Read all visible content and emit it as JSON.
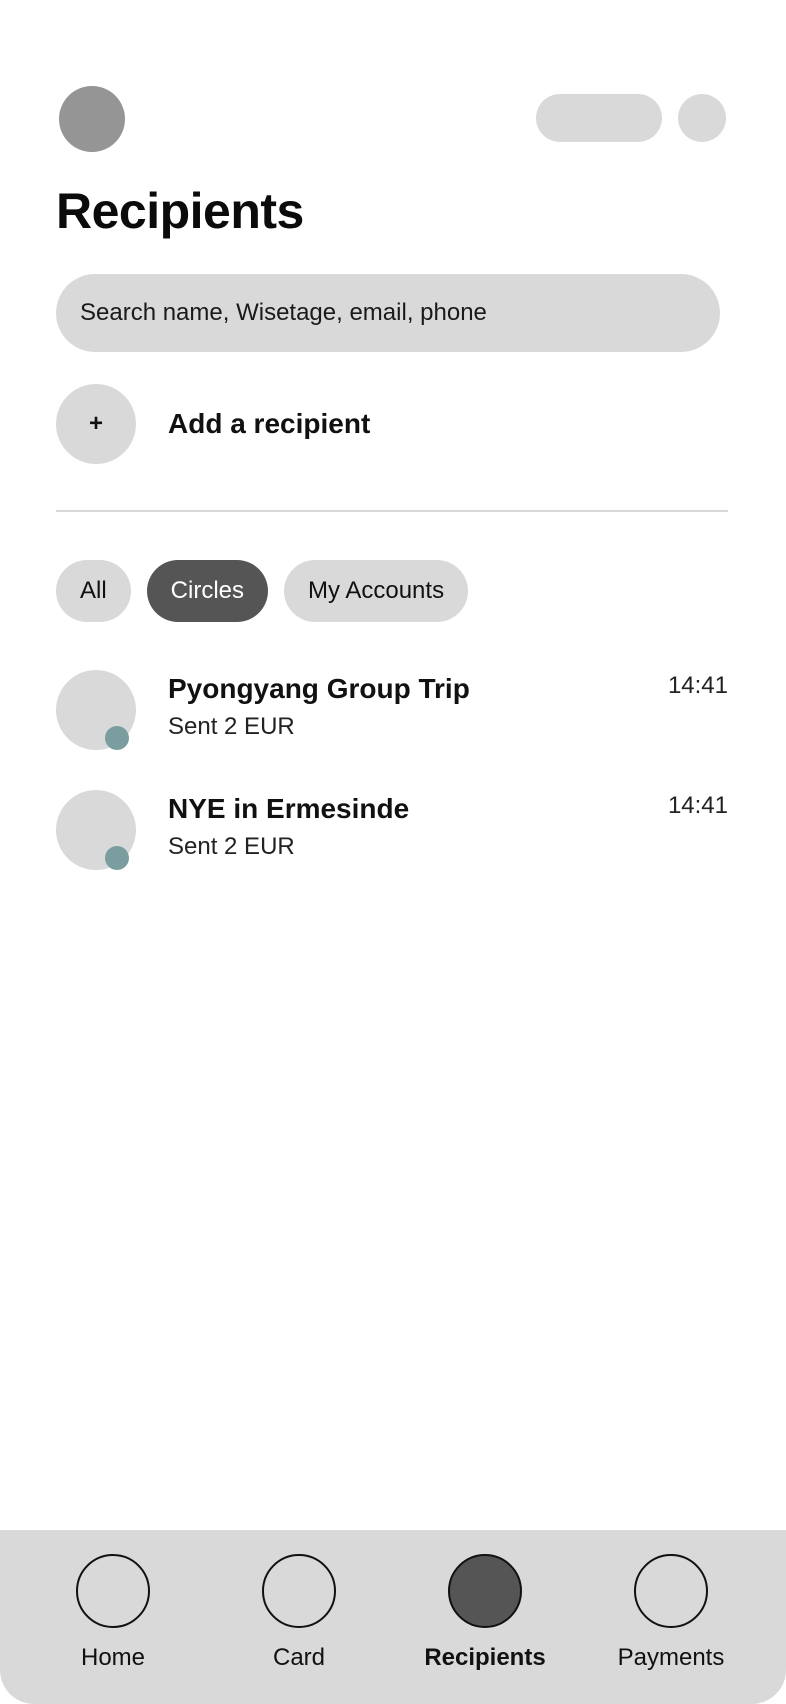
{
  "header": {
    "title": "Recipients",
    "profile_icon": "avatar-icon",
    "action_pill_icon": "pill-icon",
    "action_circle_icon": "circle-icon"
  },
  "search": {
    "placeholder": "Search name, Wisetage, email, phone"
  },
  "add_recipient": {
    "icon_glyph": "+",
    "label": "Add a recipient"
  },
  "filters": {
    "items": [
      {
        "label": "All",
        "active": false
      },
      {
        "label": "Circles",
        "active": true
      },
      {
        "label": "My Accounts",
        "active": false
      }
    ]
  },
  "recipients": [
    {
      "name": "Pyongyang Group Trip",
      "subtitle": "Sent 2 EUR",
      "time": "14:41"
    },
    {
      "name": "NYE in Ermesinde",
      "subtitle": "Sent 2 EUR",
      "time": "14:41"
    }
  ],
  "bottom_nav": {
    "items": [
      {
        "label": "Home",
        "active": false
      },
      {
        "label": "Card",
        "active": false
      },
      {
        "label": "Recipients",
        "active": true
      },
      {
        "label": "Payments",
        "active": false
      }
    ]
  },
  "colors": {
    "placeholder_gray": "#d9d9d9",
    "active_dark": "#555555",
    "status_dot": "#7a9e9f",
    "profile_gray": "#959595"
  }
}
